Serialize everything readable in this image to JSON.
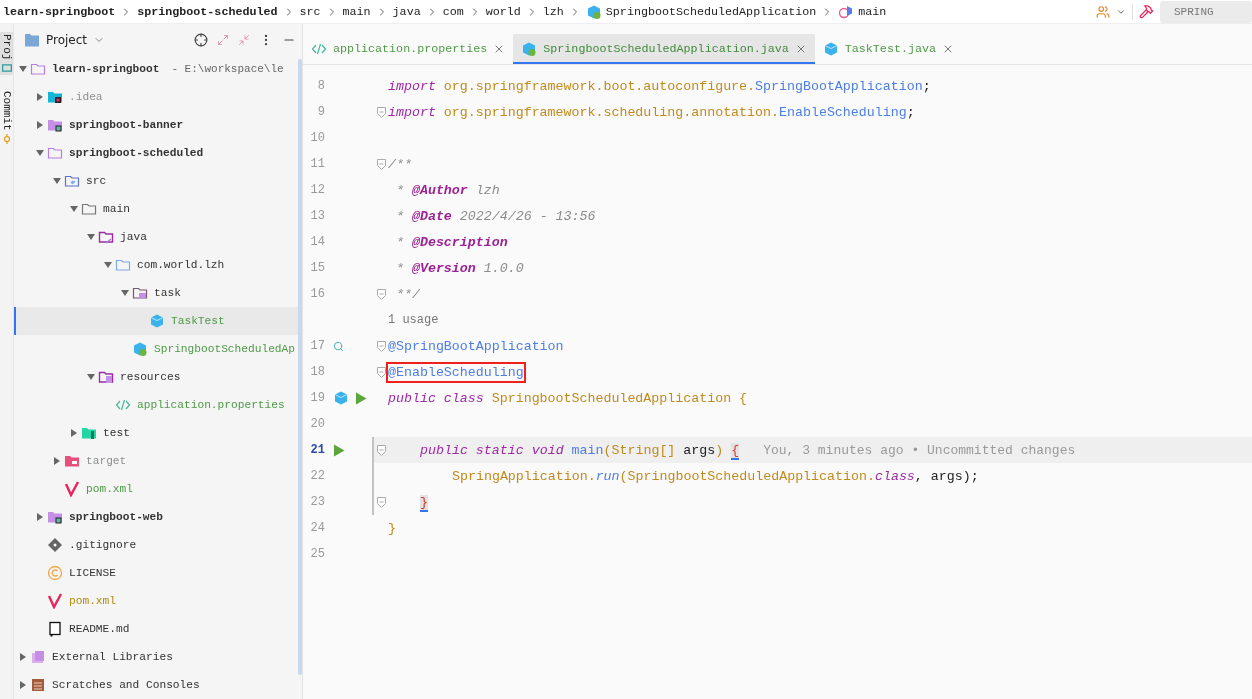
{
  "breadcrumbs": [
    {
      "label": "learn-springboot",
      "bold": true
    },
    {
      "label": "springboot-scheduled",
      "bold": true
    },
    {
      "label": "src",
      "bold": false
    },
    {
      "label": "main",
      "bold": false
    },
    {
      "label": "java",
      "bold": false
    },
    {
      "label": "com",
      "bold": false
    },
    {
      "label": "world",
      "bold": false
    },
    {
      "label": "lzh",
      "bold": false
    },
    {
      "label": "SpringbootScheduledApplication",
      "kind": "spring-class",
      "bold": false
    },
    {
      "label": "main",
      "kind": "method",
      "bold": false
    }
  ],
  "toolbar": {
    "run_config": "SPRING"
  },
  "side_tabs": [
    {
      "label": "Proj",
      "kind": "project",
      "selected": true
    },
    {
      "label": "Commit",
      "kind": "commit",
      "selected": false
    }
  ],
  "project": {
    "title": "Project",
    "tree": [
      {
        "label": "learn-springboot",
        "note": "- E:\\workspace\\le",
        "kind": "module-open",
        "bold": true,
        "color": "#333333",
        "expanded": true,
        "selected": false,
        "children": [
          {
            "label": ".idea",
            "kind": "idea",
            "bold": false,
            "color": "#8f8f8f",
            "expanded": false,
            "selected": false
          },
          {
            "label": "springboot-banner",
            "kind": "module",
            "bold": true,
            "color": "#333333",
            "expanded": false,
            "selected": false
          },
          {
            "label": "springboot-scheduled",
            "kind": "module-open",
            "bold": true,
            "color": "#333333",
            "expanded": true,
            "selected": false,
            "children": [
              {
                "label": "src",
                "kind": "source",
                "bold": false,
                "expanded": true,
                "selected": false,
                "children": [
                  {
                    "label": "main",
                    "kind": "folder",
                    "bold": false,
                    "expanded": true,
                    "selected": false,
                    "children": [
                      {
                        "label": "java",
                        "kind": "java-root",
                        "bold": false,
                        "expanded": true,
                        "selected": false,
                        "children": [
                          {
                            "label": "com.world.lzh",
                            "kind": "package",
                            "bold": false,
                            "color": "#333333",
                            "expanded": true,
                            "selected": false,
                            "children": [
                              {
                                "label": "task",
                                "kind": "task-package",
                                "bold": false,
                                "expanded": true,
                                "selected": false,
                                "children": [
                                  {
                                    "label": "TaskTest",
                                    "kind": "java-class",
                                    "bold": false,
                                    "color": "#4d9a45",
                                    "selected": true
                                  }
                                ]
                              },
                              {
                                "label": "SpringbootScheduledAp",
                                "kind": "spring-class",
                                "bold": false,
                                "color": "#4d9a45",
                                "selected": false
                              }
                            ]
                          }
                        ]
                      },
                      {
                        "label": "resources",
                        "kind": "resources",
                        "bold": false,
                        "color": "#333333",
                        "expanded": true,
                        "selected": false,
                        "children": [
                          {
                            "label": "application.properties",
                            "kind": "properties",
                            "bold": false,
                            "color": "#4d9a45",
                            "selected": false
                          }
                        ]
                      }
                    ]
                  },
                  {
                    "label": "test",
                    "kind": "test",
                    "bold": false,
                    "expanded": false,
                    "selected": false
                  }
                ]
              },
              {
                "label": "target",
                "kind": "excluded",
                "bold": false,
                "color": "#8f8f8f",
                "expanded": false,
                "selected": false
              },
              {
                "label": "pom.xml",
                "kind": "maven",
                "bold": false,
                "color": "#4d9a45",
                "selected": false
              }
            ]
          },
          {
            "label": "springboot-web",
            "kind": "module",
            "bold": true,
            "color": "#333333",
            "expanded": false,
            "selected": false
          },
          {
            "label": ".gitignore",
            "kind": "git",
            "bold": false,
            "color": "#333333",
            "selected": false
          },
          {
            "label": "LICENSE",
            "kind": "license",
            "bold": false,
            "color": "#333333",
            "selected": false
          },
          {
            "label": "pom.xml",
            "kind": "maven",
            "bold": false,
            "color": "#b58a0e",
            "selected": false
          },
          {
            "label": "README.md",
            "kind": "markdown",
            "bold": false,
            "color": "#333333",
            "selected": false
          }
        ]
      },
      {
        "label": "External Libraries",
        "kind": "library",
        "bold": false,
        "color": "#333333",
        "expanded": false,
        "selected": false
      },
      {
        "label": "Scratches and Consoles",
        "kind": "scratches",
        "bold": false,
        "color": "#333333",
        "expanded": false,
        "selected": false
      }
    ]
  },
  "editor": {
    "tabs": [
      {
        "label": "application.properties",
        "kind": "properties",
        "selected": false
      },
      {
        "label": "SpringbootScheduledApplication.java",
        "kind": "spring-class",
        "selected": true
      },
      {
        "label": "TaskTest.java",
        "kind": "java-class",
        "selected": false
      }
    ],
    "lines": [
      {
        "number": "8",
        "tokens": [
          {
            "kind": "kw",
            "text": "import "
          },
          {
            "kind": "pkg",
            "text": "org.springframework.boot.autoconfigure."
          },
          {
            "kind": "type",
            "text": "SpringBootApplication"
          },
          {
            "kind": "plain",
            "text": ";"
          }
        ]
      },
      {
        "number": "9",
        "gutter": [
          {
            "kind": "fold"
          }
        ],
        "tokens": [
          {
            "kind": "kw",
            "text": "import "
          },
          {
            "kind": "pkg",
            "text": "org.springframework.scheduling.annotation."
          },
          {
            "kind": "type",
            "text": "EnableScheduling"
          },
          {
            "kind": "plain",
            "text": ";"
          }
        ]
      },
      {
        "number": "10"
      },
      {
        "number": "11",
        "gutter": [
          {
            "kind": "fold"
          }
        ],
        "tokens": [
          {
            "kind": "comment",
            "text": "/**"
          }
        ]
      },
      {
        "number": "12",
        "tokens": [
          {
            "kind": "comment",
            "text": " * "
          },
          {
            "kind": "doctag",
            "text": "@Author"
          },
          {
            "kind": "comment",
            "text": " lzh"
          }
        ]
      },
      {
        "number": "13",
        "tokens": [
          {
            "kind": "comment",
            "text": " * "
          },
          {
            "kind": "doctag",
            "text": "@Date"
          },
          {
            "kind": "comment",
            "text": " 2022/4/26 - 13:56"
          }
        ]
      },
      {
        "number": "14",
        "tokens": [
          {
            "kind": "comment",
            "text": " * "
          },
          {
            "kind": "doctag",
            "text": "@Description"
          }
        ]
      },
      {
        "number": "15",
        "tokens": [
          {
            "kind": "comment",
            "text": " * "
          },
          {
            "kind": "doctag",
            "text": "@Version"
          },
          {
            "kind": "comment",
            "text": " 1.0.0"
          }
        ]
      },
      {
        "number": "16",
        "gutter": [
          {
            "kind": "fold"
          }
        ],
        "tokens": [
          {
            "kind": "comment",
            "text": " **/"
          }
        ]
      },
      {
        "kind": "hint",
        "text": "1 usage"
      },
      {
        "number": "17",
        "gutter": [
          {
            "kind": "find"
          },
          {
            "kind": "fold"
          }
        ],
        "tokens": [
          {
            "kind": "type",
            "text": "@SpringBootApplication"
          }
        ]
      },
      {
        "number": "18",
        "gutter": [
          {
            "kind": "fold"
          }
        ],
        "boxed": true,
        "tokens": [
          {
            "kind": "type",
            "text": "@EnableScheduling"
          }
        ]
      },
      {
        "number": "19",
        "gutter": [
          {
            "kind": "bean"
          },
          {
            "kind": "run"
          }
        ],
        "tokens": [
          {
            "kind": "kw",
            "text": "public class "
          },
          {
            "kind": "cls",
            "text": "SpringbootScheduledApplication {"
          }
        ]
      },
      {
        "number": "20"
      },
      {
        "number": "21",
        "kind": "member",
        "gutter": [
          {
            "kind": "run"
          },
          {
            "kind": "fold"
          }
        ],
        "current": true,
        "changed": true,
        "blame": "You, 3 minutes ago • Uncommitted changes",
        "tokens": [
          {
            "kind": "kw",
            "text": "public static void "
          },
          {
            "kind": "method",
            "text": "main"
          },
          {
            "kind": "cls",
            "text": "(String[] "
          },
          {
            "kind": "plain",
            "text": "args"
          },
          {
            "kind": "cls",
            "text": ") "
          },
          {
            "kind": "brace",
            "text": "{"
          }
        ]
      },
      {
        "number": "22",
        "kind": "statement",
        "changed": true,
        "tokens": [
          {
            "kind": "cls",
            "text": "SpringApplication."
          },
          {
            "kind": "static",
            "text": "run"
          },
          {
            "kind": "cls",
            "text": "(SpringbootScheduledApplication."
          },
          {
            "kind": "kw",
            "text": "class"
          },
          {
            "kind": "plain",
            "text": ", args);"
          }
        ]
      },
      {
        "number": "23",
        "kind": "member",
        "gutter": [
          {
            "kind": "fold"
          }
        ],
        "changed": true,
        "tokens": [
          {
            "kind": "brace",
            "text": "}"
          }
        ]
      },
      {
        "number": "24",
        "tokens": [
          {
            "kind": "cls",
            "text": "}"
          }
        ]
      },
      {
        "number": "25"
      }
    ]
  }
}
